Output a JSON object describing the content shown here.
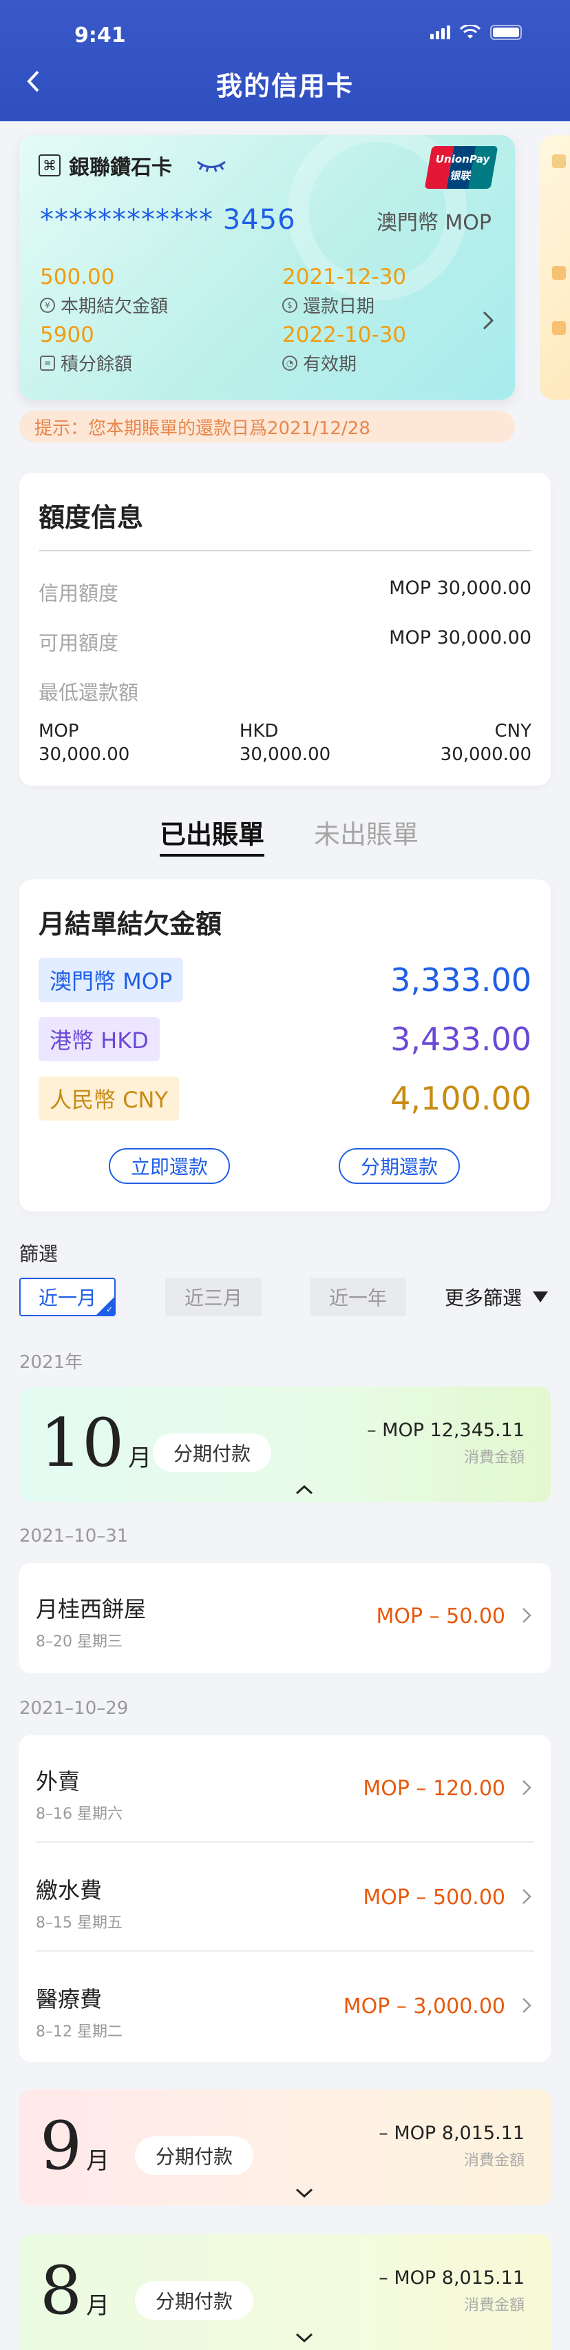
{
  "status": {
    "time": "9:41"
  },
  "nav": {
    "title": "我的信用卡"
  },
  "card": {
    "name": "銀聯鑽石卡",
    "number": "************ 3456",
    "currency": "澳門幣 MOP",
    "unionpay_text": "UnionPay 银联",
    "balance_value": "500.00",
    "balance_label": "本期結欠金額",
    "due_value": "2021-12-30",
    "due_label": "還款日期",
    "points_value": "5900",
    "points_label": "積分餘額",
    "expiry_value": "2022-10-30",
    "expiry_label": "有效期"
  },
  "notice": "提示：您本期賬單的還款日爲2021/12/28",
  "limits": {
    "title": "額度信息",
    "rows": [
      {
        "label": "信用額度",
        "value": "MOP  30,000.00"
      },
      {
        "label": "可用額度",
        "value": "MOP  30,000.00"
      },
      {
        "label": "最低還款額",
        "value": ""
      }
    ],
    "min_payment": [
      {
        "currency": "MOP",
        "amount": "30,000.00"
      },
      {
        "currency": "HKD",
        "amount": "30,000.00"
      },
      {
        "currency": "CNY",
        "amount": "30,000.00"
      }
    ]
  },
  "tabs": {
    "active": "已出賬單",
    "inactive": "未出賬單"
  },
  "balance": {
    "title": "月結單結欠金額",
    "rows": [
      {
        "label": "澳門幣 MOP",
        "amount": "3,333.00",
        "color": "#1f5ee7",
        "bg": "#e2edff"
      },
      {
        "label": "港幣 HKD",
        "amount": "3,433.00",
        "color": "#6b49d6",
        "bg": "#ece6ff"
      },
      {
        "label": "人民幣 CNY",
        "amount": "4,100.00",
        "color": "#c88b12",
        "bg": "#fff0d8"
      }
    ],
    "pay_now": "立即還款",
    "pay_installment": "分期還款"
  },
  "filter": {
    "label": "篩選",
    "chips": [
      "近一月",
      "近三月",
      "近一年"
    ],
    "more": "更多篩選"
  },
  "year_label": "2021年",
  "months": [
    {
      "num": "10",
      "unit": "月",
      "pill": "分期付款",
      "amount": "– MOP 12,345.11",
      "sub": "消費金額",
      "expanded": true
    },
    {
      "num": "9",
      "unit": "月",
      "pill": "分期付款",
      "amount": "– MOP 8,015.11",
      "sub": "消費金額",
      "expanded": false
    },
    {
      "num": "8",
      "unit": "月",
      "pill": "分期付款",
      "amount": "– MOP 8,015.11",
      "sub": "消費金額",
      "expanded": false
    }
  ],
  "groups": [
    {
      "date": "2021–10–31",
      "items": [
        {
          "name": "月桂西餅屋",
          "date": "8–20 星期三",
          "amount": "MOP – 50.00"
        }
      ]
    },
    {
      "date": "2021–10–29",
      "items": [
        {
          "name": "外賣",
          "date": "8–16 星期六",
          "amount": "MOP – 120.00"
        },
        {
          "name": "繳水費",
          "date": "8–15 星期五",
          "amount": "MOP – 500.00"
        },
        {
          "name": "醫療費",
          "date": "8–12 星期二",
          "amount": "MOP – 3,000.00"
        }
      ]
    }
  ]
}
